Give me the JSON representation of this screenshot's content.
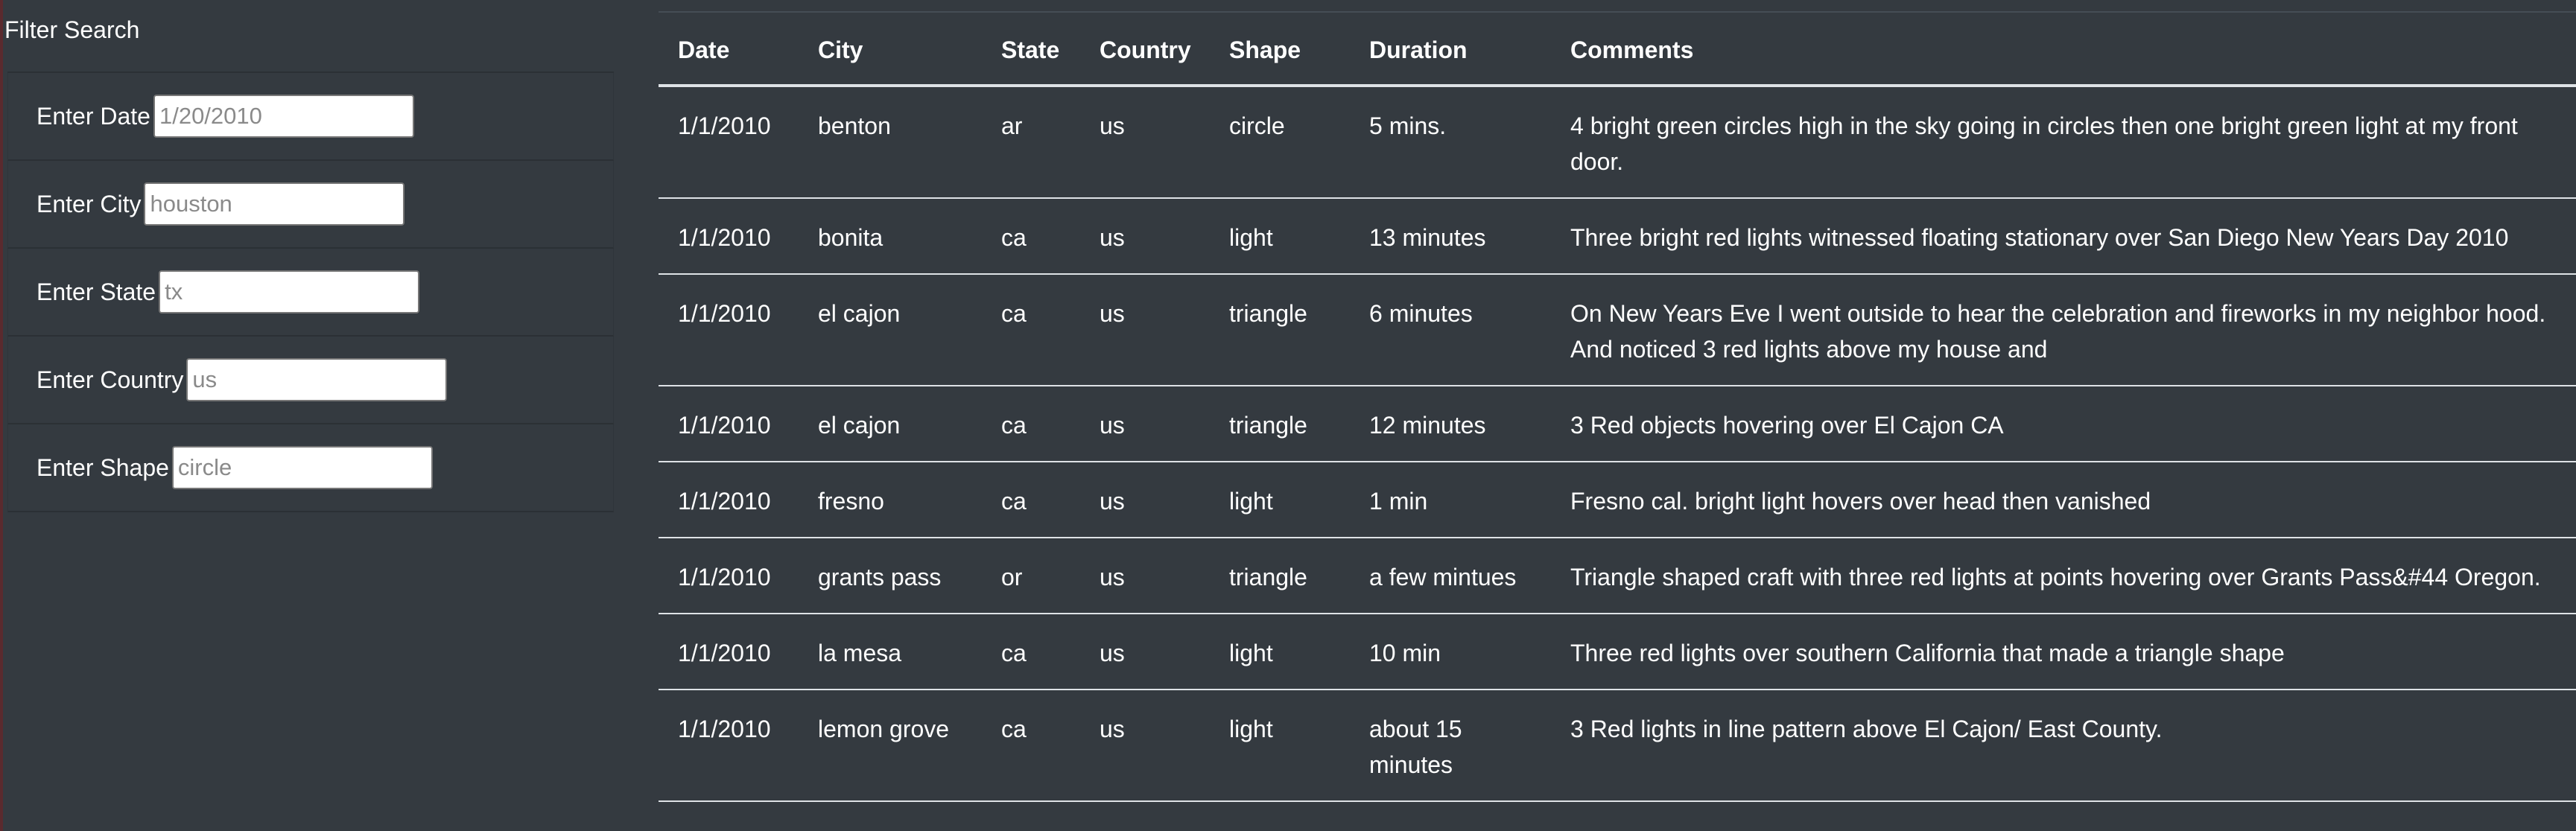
{
  "filter": {
    "title": "Filter Search",
    "fields": [
      {
        "label": "Enter Date",
        "placeholder": "1/20/2010",
        "value": ""
      },
      {
        "label": "Enter City",
        "placeholder": "houston",
        "value": ""
      },
      {
        "label": "Enter State",
        "placeholder": "tx",
        "value": ""
      },
      {
        "label": "Enter Country",
        "placeholder": "us",
        "value": ""
      },
      {
        "label": "Enter Shape",
        "placeholder": "circle",
        "value": ""
      }
    ]
  },
  "table": {
    "headers": [
      "Date",
      "City",
      "State",
      "Country",
      "Shape",
      "Duration",
      "Comments"
    ],
    "rows": [
      [
        "1/1/2010",
        "benton",
        "ar",
        "us",
        "circle",
        "5 mins.",
        "4 bright green circles high in the sky going in circles then one bright green light at my front door."
      ],
      [
        "1/1/2010",
        "bonita",
        "ca",
        "us",
        "light",
        "13 minutes",
        "Three bright red lights witnessed floating stationary over San Diego New Years Day 2010"
      ],
      [
        "1/1/2010",
        "el cajon",
        "ca",
        "us",
        "triangle",
        "6 minutes",
        "On New Years Eve I went outside to hear the celebration and fireworks in my neighbor hood. And noticed 3 red lights above my house and"
      ],
      [
        "1/1/2010",
        "el cajon",
        "ca",
        "us",
        "triangle",
        "12 minutes",
        "3 Red objects hovering over El Cajon CA"
      ],
      [
        "1/1/2010",
        "fresno",
        "ca",
        "us",
        "light",
        "1 min",
        "Fresno cal. bright light hovers over head then vanished"
      ],
      [
        "1/1/2010",
        "grants pass",
        "or",
        "us",
        "triangle",
        "a few mintues",
        "Triangle shaped craft with three red lights at points hovering over Grants Pass&#44 Oregon."
      ],
      [
        "1/1/2010",
        "la mesa",
        "ca",
        "us",
        "light",
        "10 min",
        "Three red lights over southern California that made a triangle shape"
      ],
      [
        "1/1/2010",
        "lemon grove",
        "ca",
        "us",
        "light",
        "about 15 minutes",
        "3 Red lights in line pattern above El Cajon/ East County."
      ]
    ]
  }
}
